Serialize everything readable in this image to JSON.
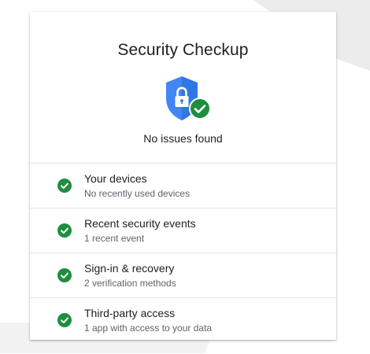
{
  "card": {
    "title": "Security Checkup",
    "status": "No issues found",
    "shield_icon": "shield-lock-icon",
    "check_badge_icon": "check-circle-icon"
  },
  "items": [
    {
      "title": "Your devices",
      "subtitle": "No recently used devices",
      "icon": "check-circle-icon"
    },
    {
      "title": "Recent security events",
      "subtitle": "1 recent event",
      "icon": "check-circle-icon"
    },
    {
      "title": "Sign-in & recovery",
      "subtitle": "2 verification methods",
      "icon": "check-circle-icon"
    },
    {
      "title": "Third-party access",
      "subtitle": "1 app with access to your data",
      "icon": "check-circle-icon"
    }
  ],
  "colors": {
    "shield_blue": "#4285f4",
    "shield_blue_dark": "#1967d2",
    "check_green": "#1e8e3e",
    "divider": "#e6e6e6",
    "text_primary": "#202124",
    "text_secondary": "#5f6368"
  }
}
